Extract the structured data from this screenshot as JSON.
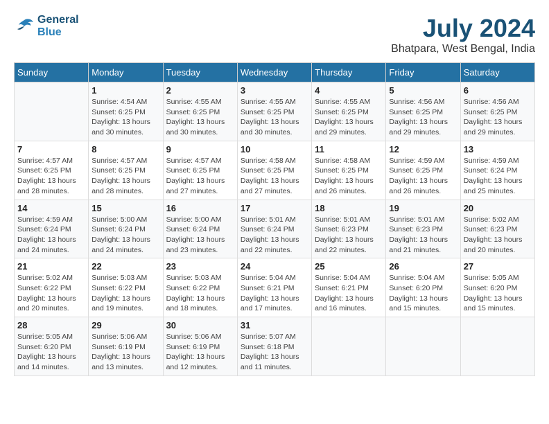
{
  "header": {
    "logo_line1": "General",
    "logo_line2": "Blue",
    "month": "July 2024",
    "location": "Bhatpara, West Bengal, India"
  },
  "days_of_week": [
    "Sunday",
    "Monday",
    "Tuesday",
    "Wednesday",
    "Thursday",
    "Friday",
    "Saturday"
  ],
  "weeks": [
    [
      {
        "day": "",
        "info": ""
      },
      {
        "day": "1",
        "info": "Sunrise: 4:54 AM\nSunset: 6:25 PM\nDaylight: 13 hours\nand 30 minutes."
      },
      {
        "day": "2",
        "info": "Sunrise: 4:55 AM\nSunset: 6:25 PM\nDaylight: 13 hours\nand 30 minutes."
      },
      {
        "day": "3",
        "info": "Sunrise: 4:55 AM\nSunset: 6:25 PM\nDaylight: 13 hours\nand 30 minutes."
      },
      {
        "day": "4",
        "info": "Sunrise: 4:55 AM\nSunset: 6:25 PM\nDaylight: 13 hours\nand 29 minutes."
      },
      {
        "day": "5",
        "info": "Sunrise: 4:56 AM\nSunset: 6:25 PM\nDaylight: 13 hours\nand 29 minutes."
      },
      {
        "day": "6",
        "info": "Sunrise: 4:56 AM\nSunset: 6:25 PM\nDaylight: 13 hours\nand 29 minutes."
      }
    ],
    [
      {
        "day": "7",
        "info": "Sunrise: 4:57 AM\nSunset: 6:25 PM\nDaylight: 13 hours\nand 28 minutes."
      },
      {
        "day": "8",
        "info": "Sunrise: 4:57 AM\nSunset: 6:25 PM\nDaylight: 13 hours\nand 28 minutes."
      },
      {
        "day": "9",
        "info": "Sunrise: 4:57 AM\nSunset: 6:25 PM\nDaylight: 13 hours\nand 27 minutes."
      },
      {
        "day": "10",
        "info": "Sunrise: 4:58 AM\nSunset: 6:25 PM\nDaylight: 13 hours\nand 27 minutes."
      },
      {
        "day": "11",
        "info": "Sunrise: 4:58 AM\nSunset: 6:25 PM\nDaylight: 13 hours\nand 26 minutes."
      },
      {
        "day": "12",
        "info": "Sunrise: 4:59 AM\nSunset: 6:25 PM\nDaylight: 13 hours\nand 26 minutes."
      },
      {
        "day": "13",
        "info": "Sunrise: 4:59 AM\nSunset: 6:24 PM\nDaylight: 13 hours\nand 25 minutes."
      }
    ],
    [
      {
        "day": "14",
        "info": "Sunrise: 4:59 AM\nSunset: 6:24 PM\nDaylight: 13 hours\nand 24 minutes."
      },
      {
        "day": "15",
        "info": "Sunrise: 5:00 AM\nSunset: 6:24 PM\nDaylight: 13 hours\nand 24 minutes."
      },
      {
        "day": "16",
        "info": "Sunrise: 5:00 AM\nSunset: 6:24 PM\nDaylight: 13 hours\nand 23 minutes."
      },
      {
        "day": "17",
        "info": "Sunrise: 5:01 AM\nSunset: 6:24 PM\nDaylight: 13 hours\nand 22 minutes."
      },
      {
        "day": "18",
        "info": "Sunrise: 5:01 AM\nSunset: 6:23 PM\nDaylight: 13 hours\nand 22 minutes."
      },
      {
        "day": "19",
        "info": "Sunrise: 5:01 AM\nSunset: 6:23 PM\nDaylight: 13 hours\nand 21 minutes."
      },
      {
        "day": "20",
        "info": "Sunrise: 5:02 AM\nSunset: 6:23 PM\nDaylight: 13 hours\nand 20 minutes."
      }
    ],
    [
      {
        "day": "21",
        "info": "Sunrise: 5:02 AM\nSunset: 6:22 PM\nDaylight: 13 hours\nand 20 minutes."
      },
      {
        "day": "22",
        "info": "Sunrise: 5:03 AM\nSunset: 6:22 PM\nDaylight: 13 hours\nand 19 minutes."
      },
      {
        "day": "23",
        "info": "Sunrise: 5:03 AM\nSunset: 6:22 PM\nDaylight: 13 hours\nand 18 minutes."
      },
      {
        "day": "24",
        "info": "Sunrise: 5:04 AM\nSunset: 6:21 PM\nDaylight: 13 hours\nand 17 minutes."
      },
      {
        "day": "25",
        "info": "Sunrise: 5:04 AM\nSunset: 6:21 PM\nDaylight: 13 hours\nand 16 minutes."
      },
      {
        "day": "26",
        "info": "Sunrise: 5:04 AM\nSunset: 6:20 PM\nDaylight: 13 hours\nand 15 minutes."
      },
      {
        "day": "27",
        "info": "Sunrise: 5:05 AM\nSunset: 6:20 PM\nDaylight: 13 hours\nand 15 minutes."
      }
    ],
    [
      {
        "day": "28",
        "info": "Sunrise: 5:05 AM\nSunset: 6:20 PM\nDaylight: 13 hours\nand 14 minutes."
      },
      {
        "day": "29",
        "info": "Sunrise: 5:06 AM\nSunset: 6:19 PM\nDaylight: 13 hours\nand 13 minutes."
      },
      {
        "day": "30",
        "info": "Sunrise: 5:06 AM\nSunset: 6:19 PM\nDaylight: 13 hours\nand 12 minutes."
      },
      {
        "day": "31",
        "info": "Sunrise: 5:07 AM\nSunset: 6:18 PM\nDaylight: 13 hours\nand 11 minutes."
      },
      {
        "day": "",
        "info": ""
      },
      {
        "day": "",
        "info": ""
      },
      {
        "day": "",
        "info": ""
      }
    ]
  ]
}
